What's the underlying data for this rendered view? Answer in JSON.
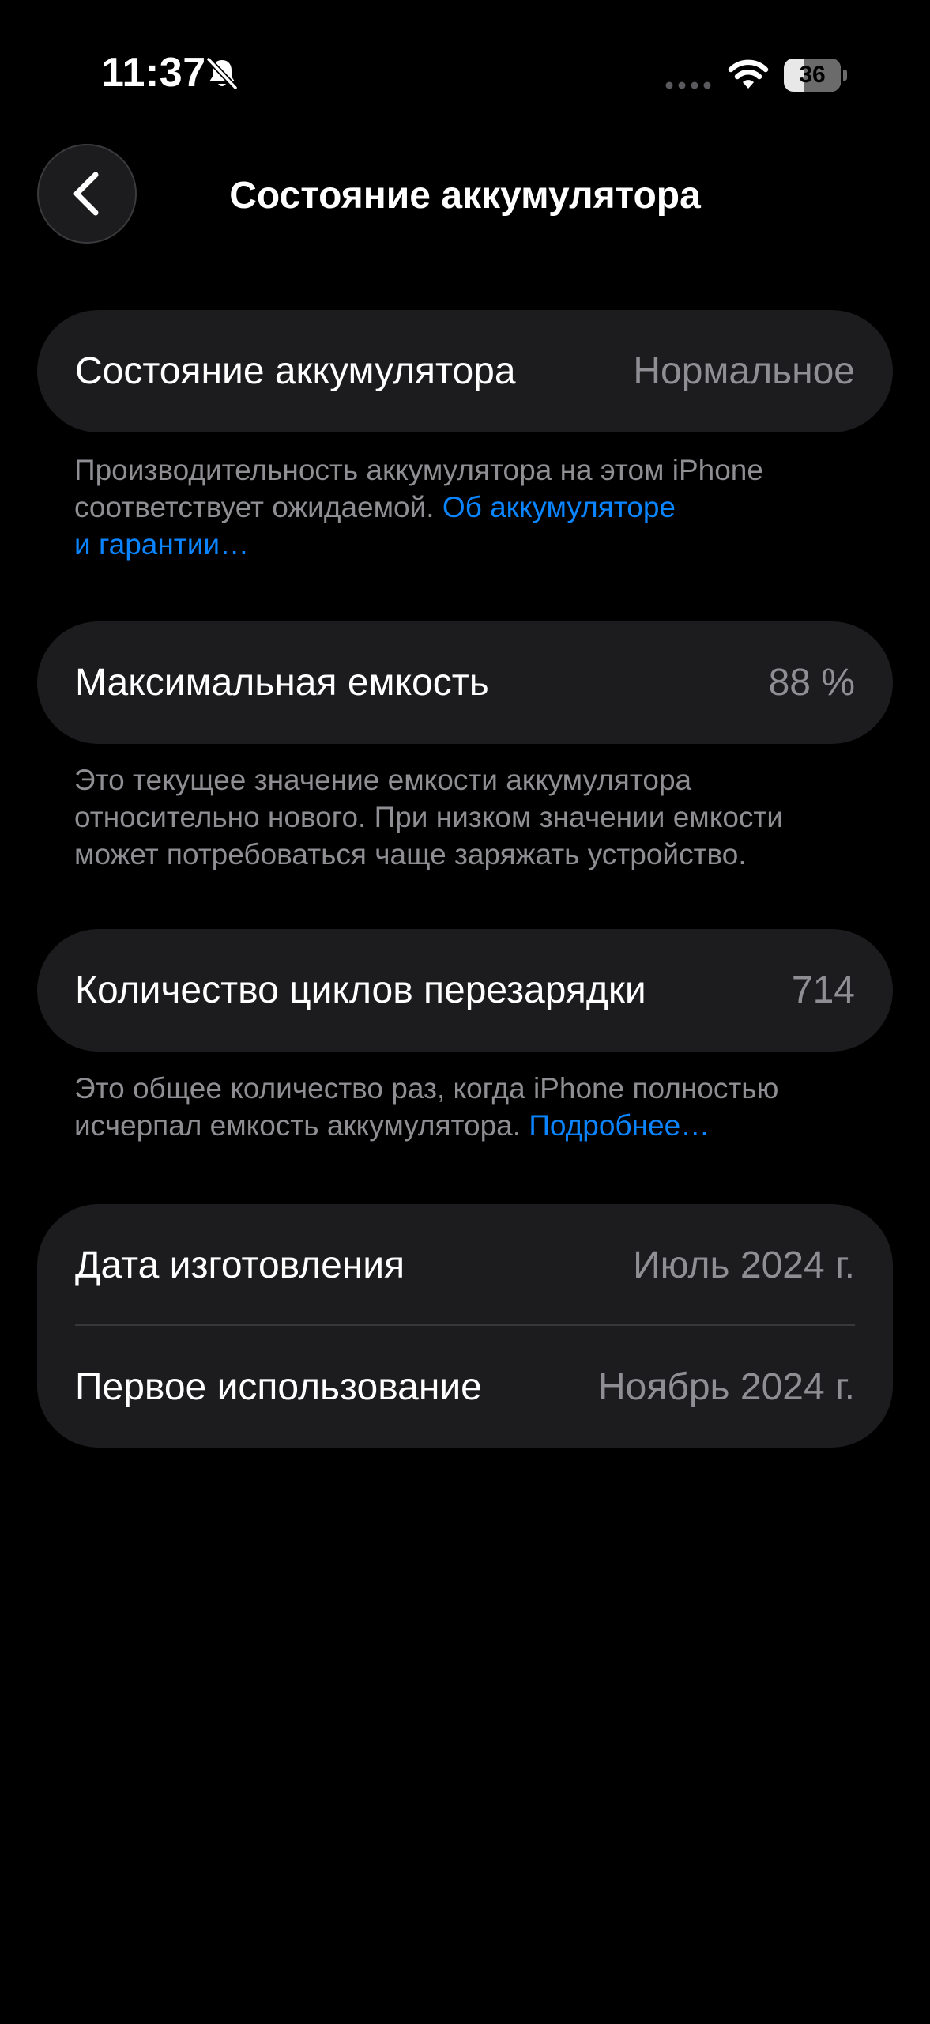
{
  "status_bar": {
    "time": "11:37",
    "battery_level": "36",
    "battery_fraction": 0.36,
    "icons": [
      "bell-slash-icon",
      "cellular-signal-icon",
      "wifi-icon",
      "battery-icon"
    ]
  },
  "nav": {
    "back_icon": "chevron-left-icon",
    "title": "Состояние аккумулятора"
  },
  "health": {
    "label": "Состояние аккумулятора",
    "value": "Нормальное",
    "footnote_text": "Производительность аккумулятора на этом iPhone соответствует ожидаемой. ",
    "footnote_link_1": "Об аккумуляторе",
    "footnote_link_2": "и гарантии…"
  },
  "capacity": {
    "label": "Максимальная емкость",
    "value": "88 %",
    "footnote_text": "Это текущее значение емкости аккумулятора относительно нового. При низком значении емкости может потребоваться чаще заряжать устройство."
  },
  "cycles": {
    "label": "Количество циклов перезарядки",
    "value": "714",
    "footnote_text": "Это общее количество раз, когда iPhone полностью исчерпал емкость аккумулятора. ",
    "footnote_link": "Подробнее…"
  },
  "dates": {
    "manufacture_label": "Дата изготовления",
    "manufacture_value": "Июль 2024 г.",
    "first_use_label": "Первое использование",
    "first_use_value": "Ноябрь 2024 г."
  },
  "colors": {
    "background": "#000000",
    "card": "#1c1c1e",
    "secondary_text": "#8e8e93",
    "link": "#0a84ff"
  }
}
